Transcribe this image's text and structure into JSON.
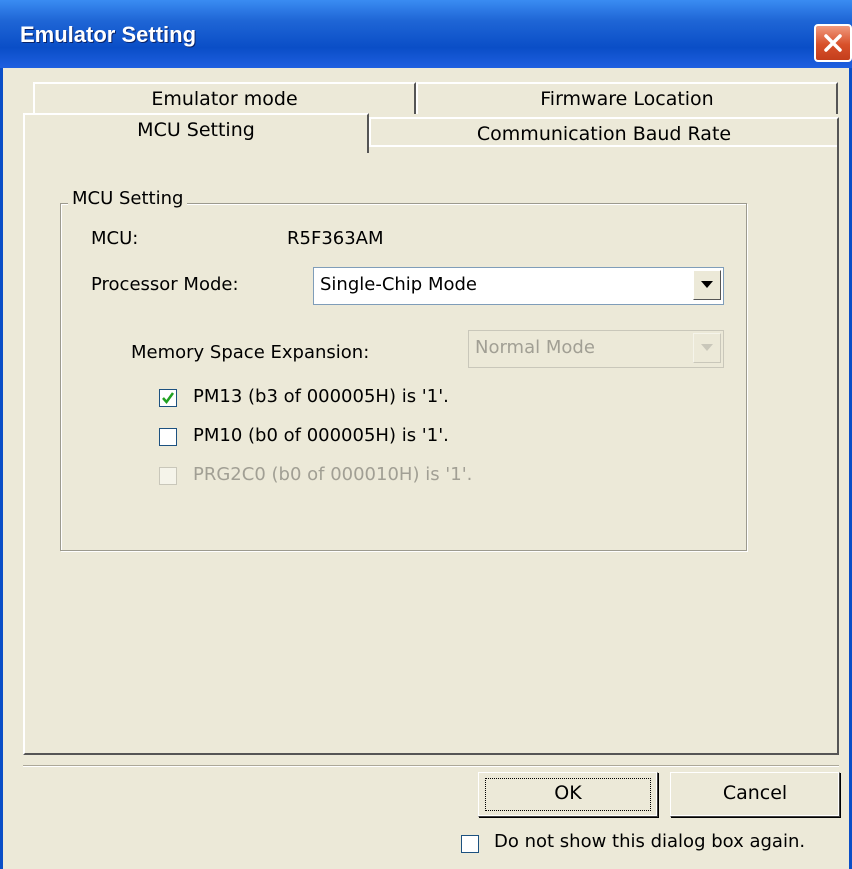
{
  "window": {
    "title": "Emulator Setting"
  },
  "tabs": {
    "row_back": [
      {
        "label": "Emulator mode"
      },
      {
        "label": "Firmware Location"
      }
    ],
    "row_front": [
      {
        "label": "MCU Setting",
        "active": true
      },
      {
        "label": "Communication Baud Rate"
      }
    ]
  },
  "group": {
    "legend": "MCU Setting",
    "mcu_label": "MCU:",
    "mcu_value": "R5F363AM",
    "processor_mode_label": "Processor Mode:",
    "processor_mode_value": "Single-Chip Mode",
    "memory_expansion_label": "Memory Space Expansion:",
    "memory_expansion_value": "Normal Mode",
    "checkboxes": [
      {
        "label": "PM13 (b3 of 000005H) is '1'.",
        "checked": true,
        "enabled": true
      },
      {
        "label": "PM10 (b0 of 000005H) is '1'.",
        "checked": false,
        "enabled": true
      },
      {
        "label": "PRG2C0 (b0 of 000010H) is '1'.",
        "checked": false,
        "enabled": false
      }
    ]
  },
  "buttons": {
    "ok": "OK",
    "cancel": "Cancel"
  },
  "footer": {
    "dont_show_label": "Do not show this dialog box again.",
    "dont_show_checked": false
  },
  "icons": {
    "close": "close-icon",
    "dropdown": "chevron-down-icon",
    "check": "checkmark-icon"
  }
}
